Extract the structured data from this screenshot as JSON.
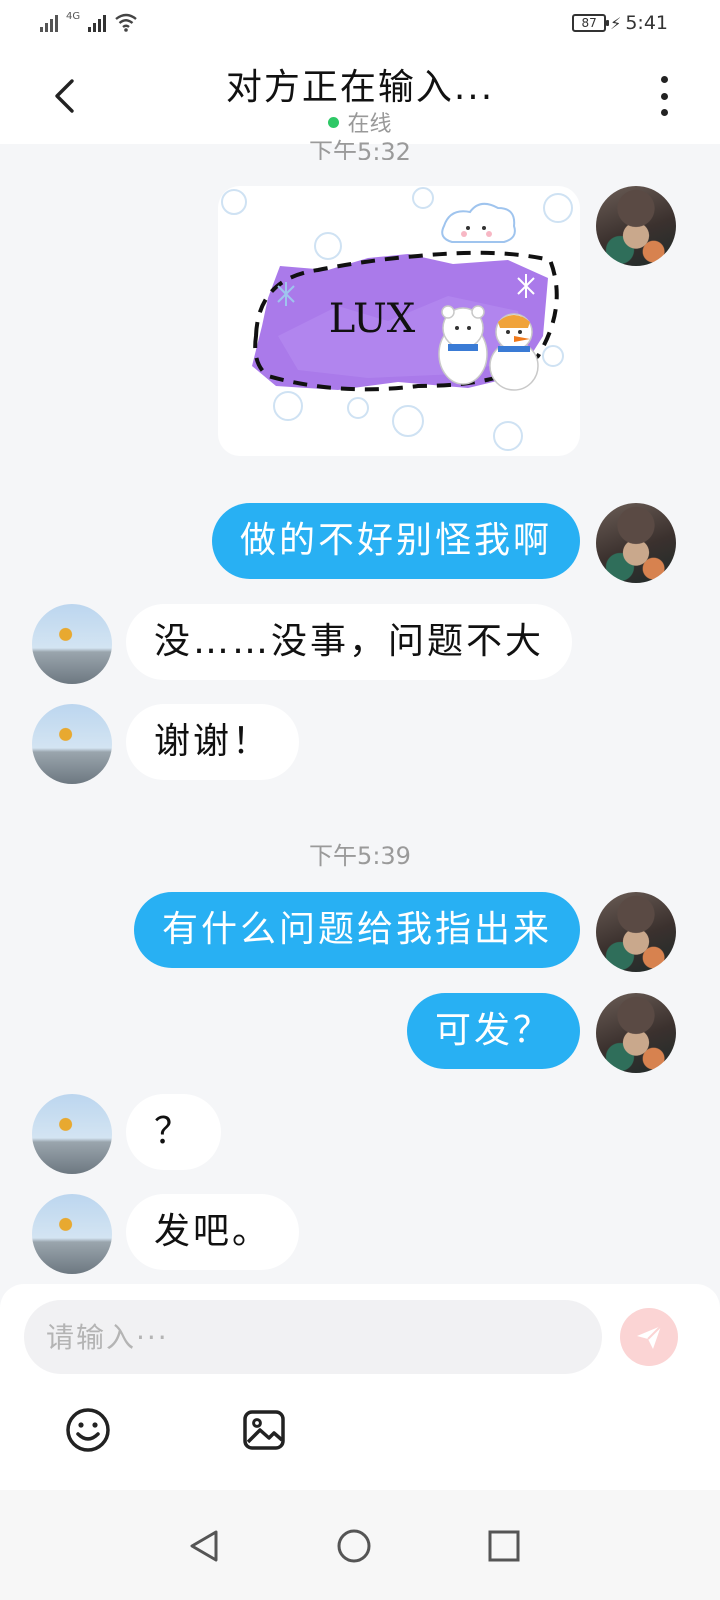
{
  "status_bar": {
    "network": "4G",
    "battery": "87",
    "time": "5:41"
  },
  "header": {
    "title": "对方正在输入...",
    "online_label": "在线",
    "online_color": "#2ec866"
  },
  "chat": {
    "time_labels": [
      "下午5:32",
      "下午5:39"
    ],
    "sticker_text": "LUX",
    "messages": [
      {
        "side": "out",
        "type": "sticker",
        "text": "LUX"
      },
      {
        "side": "out",
        "type": "text",
        "text": "做的不好别怪我啊"
      },
      {
        "side": "in",
        "type": "text",
        "text": "没……没事，问题不大"
      },
      {
        "side": "in",
        "type": "text",
        "text": "谢谢！"
      },
      {
        "side": "out",
        "type": "text",
        "text": "有什么问题给我指出来"
      },
      {
        "side": "out",
        "type": "text",
        "text": "可发？"
      },
      {
        "side": "in",
        "type": "text",
        "text": "？"
      },
      {
        "side": "in",
        "type": "text",
        "text": "发吧。"
      }
    ],
    "colors": {
      "outgoing_bubble": "#28b0f3",
      "incoming_bubble": "#ffffff",
      "background": "#f5f6f8"
    }
  },
  "composer": {
    "placeholder": "请输入···",
    "value": "",
    "send_icon": "paper-plane-icon",
    "tools": [
      "emoji-icon",
      "image-icon"
    ]
  },
  "nav": {
    "icons": [
      "back-triangle-icon",
      "home-circle-icon",
      "recents-square-icon"
    ]
  }
}
